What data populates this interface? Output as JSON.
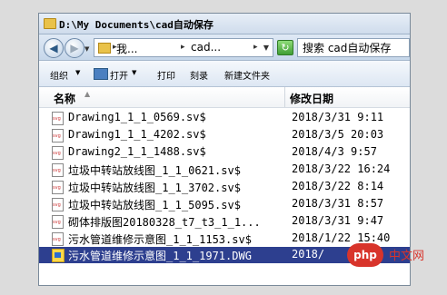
{
  "window": {
    "title": "D:\\My Documents\\cad自动保存"
  },
  "address": {
    "crumbs": [
      "我...",
      "cad..."
    ],
    "search_text": "搜索 cad自动保存"
  },
  "toolbar": {
    "organize": "组织",
    "open": "打开",
    "print": "打印",
    "burn": "刻录",
    "new_folder": "新建文件夹"
  },
  "columns": {
    "name": "名称",
    "date": "修改日期"
  },
  "files": [
    {
      "name": "Drawing1_1_1_0569.sv$",
      "date": "2018/3/31 9:11"
    },
    {
      "name": "Drawing1_1_1_4202.sv$",
      "date": "2018/3/5 20:03"
    },
    {
      "name": "Drawing2_1_1_1488.sv$",
      "date": "2018/4/3 9:57"
    },
    {
      "name": "垃圾中转站放线图_1_1_0621.sv$",
      "date": "2018/3/22 16:24"
    },
    {
      "name": "垃圾中转站放线图_1_1_3702.sv$",
      "date": "2018/3/22 8:14"
    },
    {
      "name": "垃圾中转站放线图_1_1_5095.sv$",
      "date": "2018/3/31 8:57"
    },
    {
      "name": "砌体排版图20180328_t7_t3_1_1...",
      "date": "2018/3/31 9:47"
    },
    {
      "name": "污水管道维修示意图_1_1_1153.sv$",
      "date": "2018/1/22 15:40"
    },
    {
      "name": "污水管道维修示意图_1_1_1971.DWG",
      "date": "2018/"
    }
  ],
  "watermark": {
    "logo": "php",
    "text": "中文网"
  }
}
